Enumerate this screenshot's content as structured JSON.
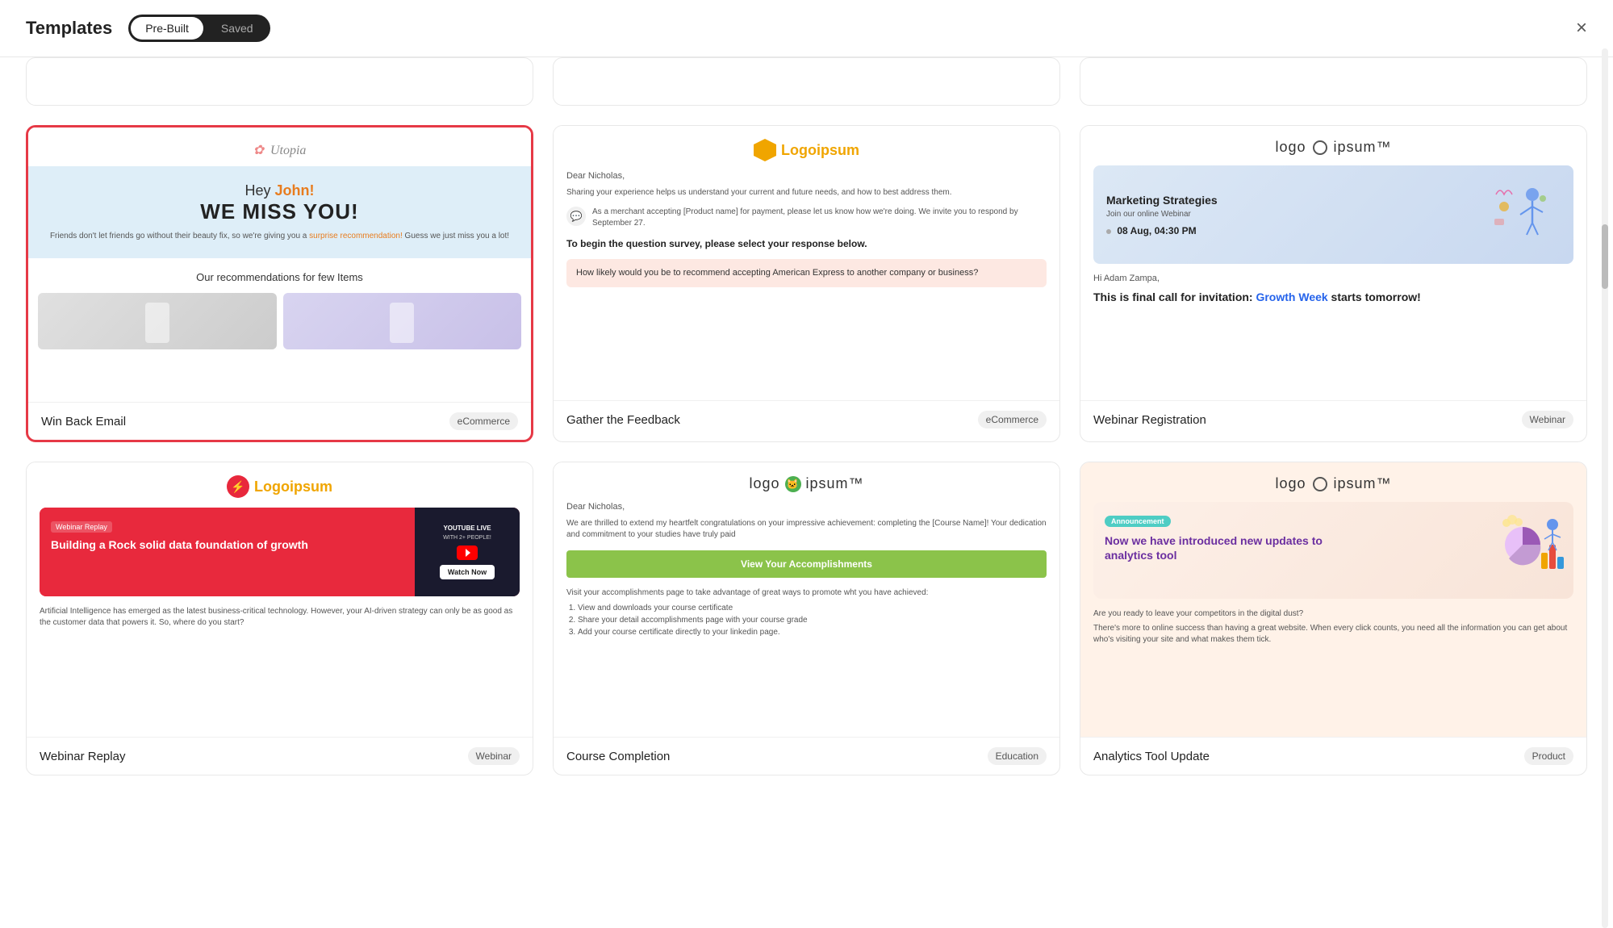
{
  "modal": {
    "title": "Templates",
    "close_label": "×"
  },
  "tabs": {
    "prebuilt": "Pre-Built",
    "saved": "Saved"
  },
  "cards": [
    {
      "id": "win-back-email",
      "title": "Win Back Email",
      "badge": "eCommerce",
      "selected": true,
      "preview_type": "winback"
    },
    {
      "id": "gather-feedback",
      "title": "Gather the Feedback",
      "badge": "eCommerce",
      "selected": false,
      "preview_type": "feedback"
    },
    {
      "id": "webinar-registration",
      "title": "Webinar Registration",
      "badge": "Webinar",
      "selected": false,
      "preview_type": "webinar"
    },
    {
      "id": "webinar-replay",
      "title": "Webinar Replay",
      "badge": "Webinar",
      "selected": false,
      "preview_type": "replay"
    },
    {
      "id": "course-completion",
      "title": "Course Completion",
      "badge": "Education",
      "selected": false,
      "preview_type": "course"
    },
    {
      "id": "analytics-update",
      "title": "Analytics Tool Update",
      "badge": "Product",
      "selected": false,
      "preview_type": "analytics"
    }
  ],
  "winback": {
    "logo_flower": "✿",
    "logo_name": "Utopia",
    "hey_text": "Hey ",
    "name": "John!",
    "miss_text": "WE MISS YOU!",
    "sub_text": "Friends don't let friends go without their beauty fix, so we're giving you a",
    "link_text": "surprise recommendation!",
    "sub_text2": " Guess we just miss you a lot!",
    "recs_title": "Our recommendations for few Items"
  },
  "feedback": {
    "logo_text": "Logo",
    "logo_accent": "ipsum",
    "dear": "Dear Nicholas,",
    "body1": "Sharing your experience helps us understand your current and future needs, and how to best address them.",
    "chat_text": "As a merchant accepting [Product name] for payment, please let us know how we're doing. We invite you to respond by September 27.",
    "question": "To begin the question survey, please select your response below.",
    "answer": "How likely would you be to recommend accepting American Express to another company or business?"
  },
  "webinar": {
    "logo_text": "logo",
    "logo_accent": "ipsum",
    "banner_title": "Marketing Strategies",
    "banner_sub": "Join our online Webinar",
    "banner_date": "08 Aug, 04:30 PM",
    "greeting": "Hi Adam Zampa,",
    "cta_text": "This is final call for invitation: ",
    "cta_accent": "Growth Week",
    "cta_text2": " starts tomorrow!"
  },
  "replay": {
    "logo_text": "Logo",
    "logo_accent": "ipsum",
    "webinar_label": "Webinar Replay",
    "banner_title": "Building a Rock solid data foundation of growth",
    "yt_label": "YOUTUBE LIVE",
    "yt_sub": "WITH 2+ PEOPLE!",
    "watch_btn": "Watch Now",
    "body_text": "Artificial Intelligence has emerged as the latest business-critical technology. However, your AI-driven strategy can only be as good as the customer data that powers it. So, where do you start?"
  },
  "course": {
    "logo_text": "logo",
    "logo_accent": "ipsum",
    "dear": "Dear Nicholas,",
    "body": "We are thrilled to extend my heartfelt congratulations on your impressive achievement: completing the [Course Name]! Your dedication and commitment to your studies have truly paid",
    "btn_text": "View Your Accomplishments",
    "foot_text": "Visit your accomplishments page to take advantage of great ways to promote wht you have achieved:",
    "list_items": [
      "View and downloads your course certificate",
      "Share your detail accomplishments page with your course grade",
      "Add your course certificate directly to your linkedin page."
    ]
  },
  "analytics": {
    "logo_text": "logo",
    "logo_accent": "ipsum",
    "announce": "Announcement",
    "banner_title": "Now we have introduced new updates to analytics tool",
    "foot_text1": "Are you ready to leave your competitors in the digital dust?",
    "foot_text2": "There's more to online success than having a great website. When every click counts, you need all the information you can get about who's visiting your site and what makes them tick."
  }
}
